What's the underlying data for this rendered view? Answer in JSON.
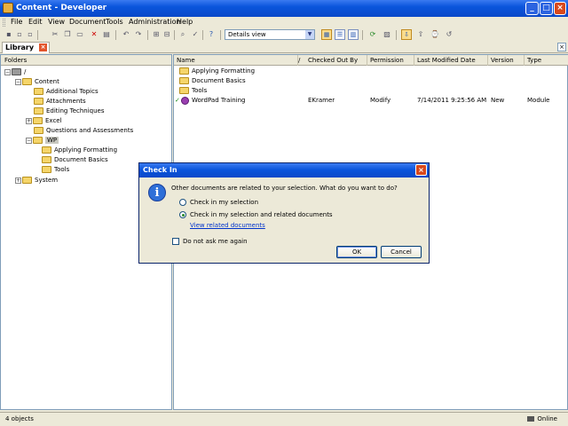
{
  "window": {
    "title": "Content - Developer"
  },
  "menu": [
    "File",
    "Edit",
    "View",
    "Document",
    "Tools",
    "Administration",
    "Help"
  ],
  "toolbar": {
    "view_select": "Details view"
  },
  "tab": {
    "label": "Library"
  },
  "folders_pane": {
    "header": "Folders",
    "tree": [
      {
        "label": "/",
        "level": 0
      },
      {
        "label": "Content",
        "level": 1
      },
      {
        "label": "Additional Topics",
        "level": 2
      },
      {
        "label": "Attachments",
        "level": 2
      },
      {
        "label": "Editing Techniques",
        "level": 2
      },
      {
        "label": "Excel",
        "level": 2
      },
      {
        "label": "Questions and Assessments",
        "level": 2
      },
      {
        "label": "WP",
        "level": 2,
        "selected": true
      },
      {
        "label": "Applying Formatting",
        "level": 3
      },
      {
        "label": "Document Basics",
        "level": 3
      },
      {
        "label": "Tools",
        "level": 3
      },
      {
        "label": "System",
        "level": 1
      }
    ]
  },
  "list": {
    "columns": [
      "Name",
      "/",
      "Checked Out By",
      "Permission",
      "Last Modified Date",
      "Version",
      "Type"
    ],
    "rows": [
      {
        "name": "Applying Formatting",
        "checked_out_by": "",
        "permission": "",
        "modified": "",
        "version": "",
        "type": ""
      },
      {
        "name": "Document Basics",
        "checked_out_by": "",
        "permission": "",
        "modified": "",
        "version": "",
        "type": ""
      },
      {
        "name": "Tools",
        "checked_out_by": "",
        "permission": "",
        "modified": "",
        "version": "",
        "type": ""
      },
      {
        "name": "WordPad Training",
        "checked_out_by": "EKramer",
        "permission": "Modify",
        "modified": "7/14/2011 9:25:56 AM",
        "version": "New",
        "type": "Module"
      }
    ]
  },
  "dialog": {
    "title": "Check In",
    "question": "Other documents are related to your selection. What do you want to do?",
    "option1": "Check in my selection",
    "option2": "Check in my selection and related documents",
    "link": "View related documents",
    "checkbox": "Do not ask me again",
    "ok": "OK",
    "cancel": "Cancel"
  },
  "status": {
    "left": "4 objects",
    "right": "Online"
  }
}
